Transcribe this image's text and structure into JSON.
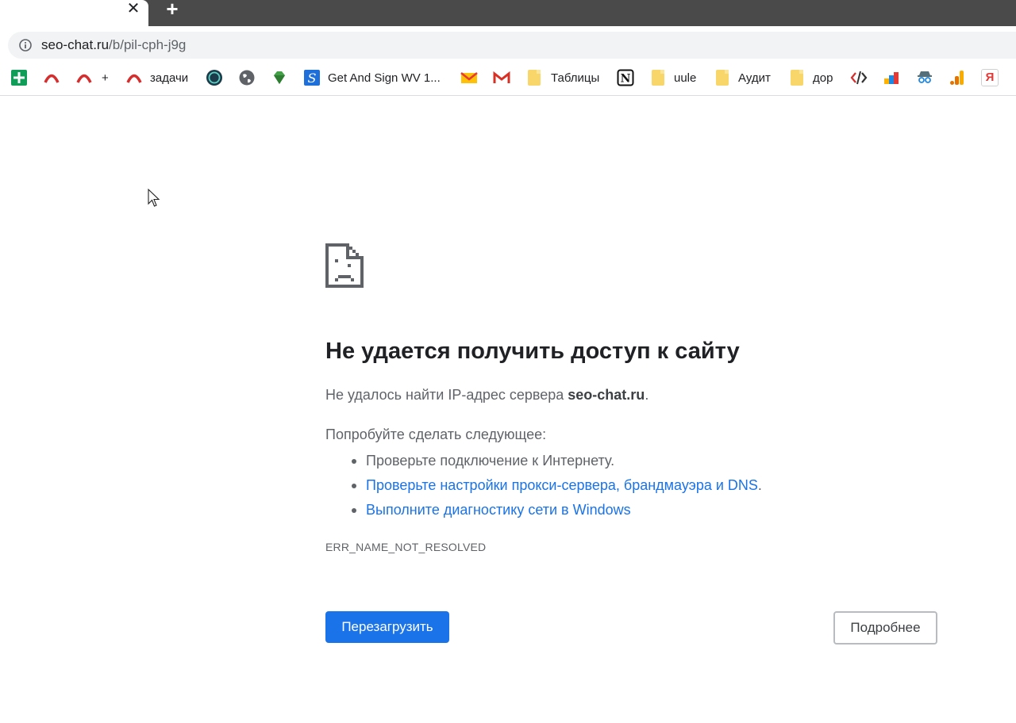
{
  "tab": {
    "close_glyph": "✕",
    "new_tab_glyph": "+"
  },
  "omnibox": {
    "host": "seo-chat.ru",
    "path": "/b/pil-cph-j9g",
    "icon": "info-icon"
  },
  "bookmarks": [
    {
      "icon": "sheets-icon",
      "label": ""
    },
    {
      "icon": "arch-red-icon",
      "label": ""
    },
    {
      "icon": "arch-red-icon",
      "label": "+"
    },
    {
      "icon": "arch-red-icon",
      "label": "задачи"
    },
    {
      "icon": "seo-round-icon",
      "label": ""
    },
    {
      "icon": "globe-icon",
      "label": ""
    },
    {
      "icon": "gem-icon",
      "label": ""
    },
    {
      "icon": "s-blue-icon",
      "label": "Get And Sign WV 1..."
    },
    {
      "icon": "mail-envelope-icon",
      "label": ""
    },
    {
      "icon": "gmail-icon",
      "label": ""
    },
    {
      "icon": "folder-icon",
      "label": "Таблицы"
    },
    {
      "icon": "notion-icon",
      "label": ""
    },
    {
      "icon": "folder-icon",
      "label": "uule"
    },
    {
      "icon": "folder-icon",
      "label": "Аудит"
    },
    {
      "icon": "folder-icon",
      "label": "дор"
    },
    {
      "icon": "code-icon",
      "label": ""
    },
    {
      "icon": "bar-chart-icon",
      "label": ""
    },
    {
      "icon": "spy-icon",
      "label": ""
    },
    {
      "icon": "analytics-icon",
      "label": ""
    },
    {
      "icon": "yandex-icon",
      "label": "Я"
    }
  ],
  "error": {
    "title": "Не удается получить доступ к сайту",
    "desc_prefix": "Не удалось найти IP-адрес сервера ",
    "desc_host": "seo-chat.ru",
    "desc_suffix": ".",
    "try_heading": "Попробуйте сделать следующее:",
    "suggestion_1": "Проверьте подключение к Интернету.",
    "suggestion_2": "Проверьте настройки прокси-сервера, брандмауэра и DNS",
    "suggestion_2_end": ".",
    "suggestion_3": "Выполните диагностику сети в Windows",
    "code": "ERR_NAME_NOT_RESOLVED",
    "reload_label": "Перезагрузить",
    "details_label": "Подробнее"
  },
  "colors": {
    "accent": "#1a73e8",
    "text": "#202124",
    "muted": "#5f6368",
    "tabstrip": "#4a4a4a"
  }
}
